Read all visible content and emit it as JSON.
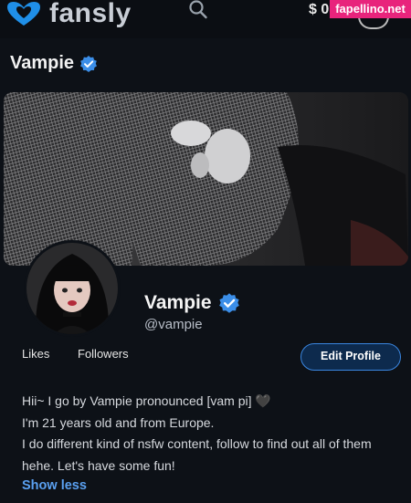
{
  "app": {
    "name": "fansly"
  },
  "header": {
    "balance": "$ 0",
    "watermark": "fapellino.net"
  },
  "page": {
    "title": "Vampie"
  },
  "profile": {
    "display_name": "Vampie",
    "handle": "@vampie",
    "likes_label": "Likes",
    "followers_label": "Followers",
    "edit_button": "Edit Profile"
  },
  "bio": {
    "lines": [
      "Hii~ I go by Vampie pronounced [vam pi] 🖤",
      "I'm 21 years old and from Europe.",
      "I do different kind of nsfw content, follow to find out all of them",
      "hehe. Let's have some fun!"
    ],
    "toggle": "Show less"
  },
  "colors": {
    "accent": "#3a86e0",
    "verified": "#3b8ee8",
    "background": "#0d1117"
  },
  "icons": {
    "logo": "fansly-logo-icon",
    "search": "search-icon",
    "verified": "verified-badge-icon"
  }
}
